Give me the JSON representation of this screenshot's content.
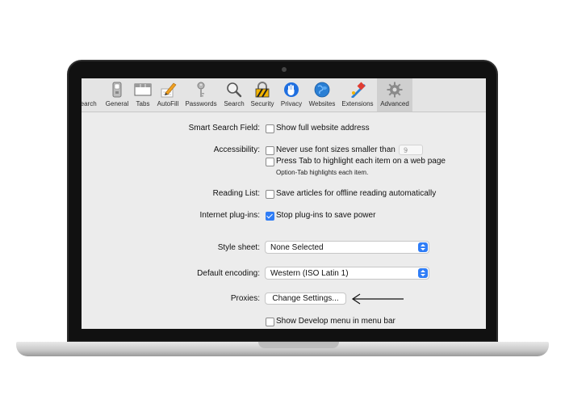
{
  "toolbar": {
    "items": [
      {
        "label": "Search",
        "icon": "search-icon"
      },
      {
        "label": "General",
        "icon": "general-switch-icon"
      },
      {
        "label": "Tabs",
        "icon": "tabs-icon"
      },
      {
        "label": "AutoFill",
        "icon": "autofill-pencil-icon"
      },
      {
        "label": "Passwords",
        "icon": "key-icon"
      },
      {
        "label": "Search",
        "icon": "magnifier-icon"
      },
      {
        "label": "Security",
        "icon": "lock-icon"
      },
      {
        "label": "Privacy",
        "icon": "hand-icon"
      },
      {
        "label": "Websites",
        "icon": "globe-icon"
      },
      {
        "label": "Extensions",
        "icon": "puzzle-icon"
      },
      {
        "label": "Advanced",
        "icon": "gear-icon"
      }
    ],
    "selected": "Advanced"
  },
  "prefs": {
    "smart_search": {
      "label": "Smart Search Field:",
      "option": "Show full website address",
      "checked": false
    },
    "accessibility": {
      "label": "Accessibility:",
      "font_option": "Never use font sizes smaller than",
      "font_size": "9",
      "tab_option": "Press Tab to highlight each item on a web page",
      "tab_note": "Option-Tab highlights each item."
    },
    "reading_list": {
      "label": "Reading List:",
      "option": "Save articles for offline reading automatically"
    },
    "plugins": {
      "label": "Internet plug-ins:",
      "option": "Stop plug-ins to save power",
      "checked": true
    },
    "style_sheet": {
      "label": "Style sheet:",
      "value": "None Selected"
    },
    "encoding": {
      "label": "Default encoding:",
      "value": "Western (ISO Latin 1)"
    },
    "proxies": {
      "label": "Proxies:",
      "button": "Change Settings..."
    },
    "develop": {
      "option": "Show Develop menu in menu bar"
    }
  },
  "colors": {
    "accent": "#2f7df6",
    "screen_bg": "#ececec",
    "toolbar_bg": "#e4e4e4"
  }
}
